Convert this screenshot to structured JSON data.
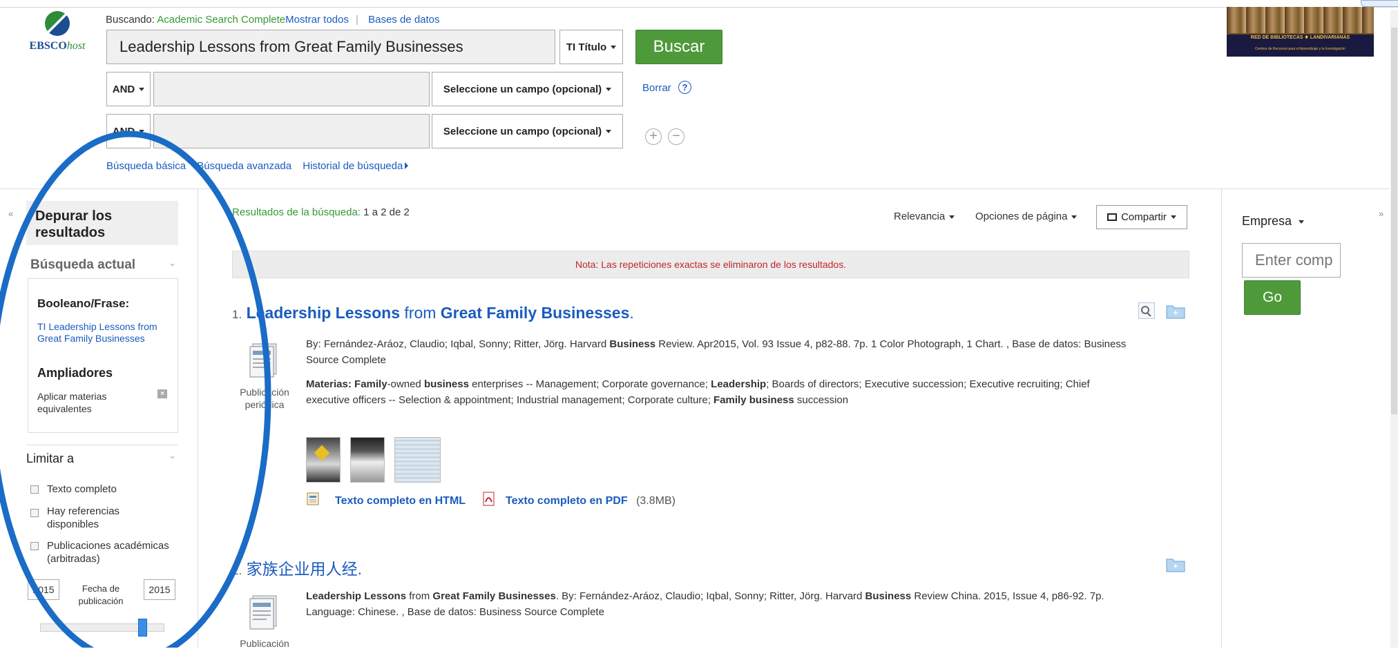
{
  "header": {
    "logo_text": "EBSCO",
    "logo_text_italic": "host",
    "searching_label": "Buscando:",
    "searching_db": "Academic Search Complete",
    "show_all": "Mostrar todos",
    "databases": "Bases de datos",
    "search_value": "Leadership Lessons from Great Family Businesses",
    "field1": "TI Título",
    "search_button": "Buscar",
    "bool2": "AND",
    "field2": "Seleccione un campo (opcional)",
    "clear": "Borrar",
    "bool3": "AND",
    "field3": "Seleccione un campo (opcional)",
    "links": [
      "Búsqueda básica",
      "Búsqueda avanzada",
      "Historial de búsqueda"
    ],
    "banner_text": "RED DE BIBLIOTECAS",
    "banner_text2": "LANDIVARIANAS",
    "banner_sub": "Centros de Recursos para el Aprendizaje y la Investigación"
  },
  "sidebar": {
    "refine_title": "Depurar los resultados",
    "current_search": "Búsqueda actual",
    "boolean_label": "Booleano/Frase:",
    "boolean_value": "TI Leadership Lessons from Great Family Businesses",
    "expanders": "Ampliadores",
    "apply_subjects": "Aplicar materias equivalentes",
    "limit_to": "Limitar a",
    "limits": [
      "Texto completo",
      "Hay referencias disponibles",
      "Publicaciones académicas (arbitradas)"
    ],
    "date_from": "2015",
    "date_label": "Fecha de publicación",
    "date_to": "2015",
    "slider_level": 0.85
  },
  "results": {
    "header_label": "Resultados de la búsqueda:",
    "header_count": "1 a 2 de 2",
    "sort": "Relevancia",
    "page_options": "Opciones de página",
    "share": "Compartir",
    "note": "Nota: Las repeticiones exactas se eliminaron de los resultados.",
    "r1": {
      "num": "1.",
      "title_b1": "Leadership Lessons",
      "title_n1": " from ",
      "title_b2": "Great Family Businesses",
      "title_end": ".",
      "meta1": "By: Fernández-Aráoz, Claudio; Iqbal, Sonny; Ritter, Jörg. Harvard ",
      "meta1_b": "Business",
      "meta1_rest": " Review. Apr2015, Vol. 93 Issue 4, p82-88. 7p. 1 Color Photograph, 1 Chart. , Base de datos: Business",
      "meta2": "Source Complete",
      "subj_label": "Materias: ",
      "subj_b1": "Family",
      "subj_t1": "-owned ",
      "subj_b2": "business",
      "subj_t2": " enterprises -- Management; Corporate governance; ",
      "subj_b3": "Leadership",
      "subj_t3": "; Boards of directors; Executive succession; Executive recruiting; Chief",
      "subj_line2a": "executive officers -- Selection & appointment; Industrial management; Corporate culture; ",
      "subj_b4": "Family business",
      "subj_line2b": " succession",
      "pub_type": "Publicación periódica",
      "html_link": "Texto completo en HTML",
      "pdf_link": "Texto completo en PDF",
      "pdf_size": "(3.8MB)"
    },
    "r2": {
      "num": "2.",
      "title": "家族企业用人经.",
      "b1": "Leadership Lessons",
      "t1": " from ",
      "b2": "Great Family Businesses",
      "t2": ". By: Fernández-Aráoz, Claudio; Iqbal, Sonny; Ritter, Jörg. Harvard ",
      "b3": "Business",
      "t3": " Review China. 2015, Issue 4, p86-92. 7p.",
      "line2": "Language: Chinese. , Base de datos: Business Source Complete",
      "pub_type": "Publicación"
    }
  },
  "right": {
    "company": "Empresa",
    "placeholder": "Enter comp",
    "go": "Go"
  },
  "colors": {
    "green": "#4e9a3a",
    "link": "#1a5bbf",
    "circle": "#1a6cc6"
  }
}
